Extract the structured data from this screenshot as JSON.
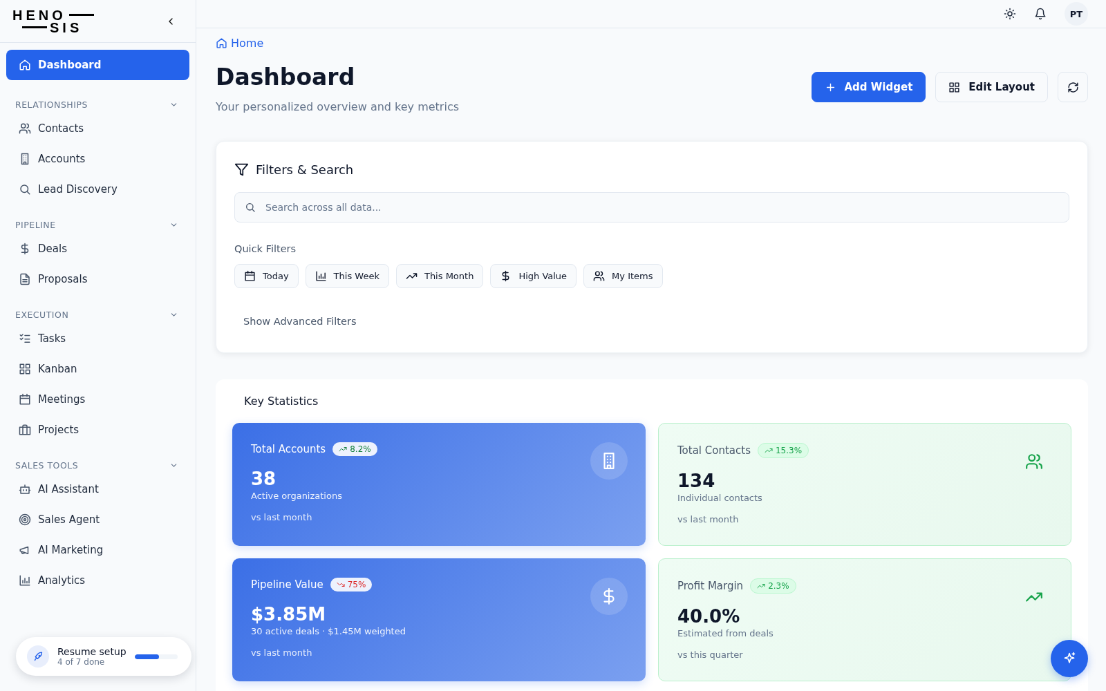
{
  "logo": {
    "line_1": "HENO",
    "line_2": "SIS"
  },
  "sidebar": {
    "items": [
      {
        "label": "Dashboard",
        "selected": true
      }
    ],
    "sections": [
      {
        "title": "RELATIONSHIPS",
        "expanded": true,
        "items": [
          {
            "label": "Contacts",
            "selected": false
          },
          {
            "label": "Accounts",
            "selected": false
          },
          {
            "label": "Lead Discovery",
            "selected": false
          }
        ]
      },
      {
        "title": "PIPELINE",
        "expanded": true,
        "items": [
          {
            "label": "Deals",
            "selected": false
          },
          {
            "label": "Proposals",
            "selected": false
          }
        ]
      },
      {
        "title": "EXECUTION",
        "expanded": true,
        "items": [
          {
            "label": "Tasks",
            "selected": false
          },
          {
            "label": "Kanban",
            "selected": false
          },
          {
            "label": "Meetings",
            "selected": false
          },
          {
            "label": "Projects",
            "selected": false
          }
        ]
      },
      {
        "title": "SALES TOOLS",
        "expanded": true,
        "items": [
          {
            "label": "AI Assistant",
            "selected": false
          },
          {
            "label": "Sales Agent",
            "selected": false
          },
          {
            "label": "AI Marketing",
            "selected": false
          },
          {
            "label": "Analytics",
            "selected": false
          }
        ]
      }
    ]
  },
  "setup_widget": {
    "title": "Resume setup",
    "progress_text": "4 of 7 done",
    "level": 0.57
  },
  "topbar": {
    "avatar": "PT"
  },
  "breadcrumb": "Home",
  "page": {
    "title": "Dashboard",
    "subtitle": "Your personalized overview and key metrics"
  },
  "actions": [
    {
      "label": "Add Widget",
      "kind": "primary"
    },
    {
      "label": "Edit Layout",
      "kind": "secondary"
    }
  ],
  "filters": {
    "title": "Filters & Search",
    "search_placeholder": "Search across all data...",
    "quick_filters_label": "Quick Filters",
    "quick_filters": [
      {
        "label": "Today"
      },
      {
        "label": "This Week"
      },
      {
        "label": "This Month"
      },
      {
        "label": "High Value"
      },
      {
        "label": "My Items"
      }
    ],
    "advanced_link": "Show Advanced Filters"
  },
  "stats": {
    "title": "Key Statistics",
    "cards": [
      {
        "kind": "primary",
        "title": "Total Accounts",
        "change": "8.2%",
        "declining": false,
        "value": "38",
        "description": "Active organizations",
        "comparison": "vs last month"
      },
      {
        "kind": "success",
        "title": "Total Contacts",
        "change": "15.3%",
        "declining": false,
        "value": "134",
        "description": "Individual contacts",
        "comparison": "vs last month"
      },
      {
        "kind": "primary",
        "title": "Pipeline Value",
        "change": "75%",
        "declining": true,
        "value": "$3.85M",
        "description": "30 active deals · $1.45M weighted",
        "comparison": "vs last month"
      },
      {
        "kind": "success",
        "title": "Profit Margin",
        "change": "2.3%",
        "declining": false,
        "value": "40.0%",
        "description": "Estimated from deals",
        "comparison": "vs this quarter"
      }
    ]
  }
}
